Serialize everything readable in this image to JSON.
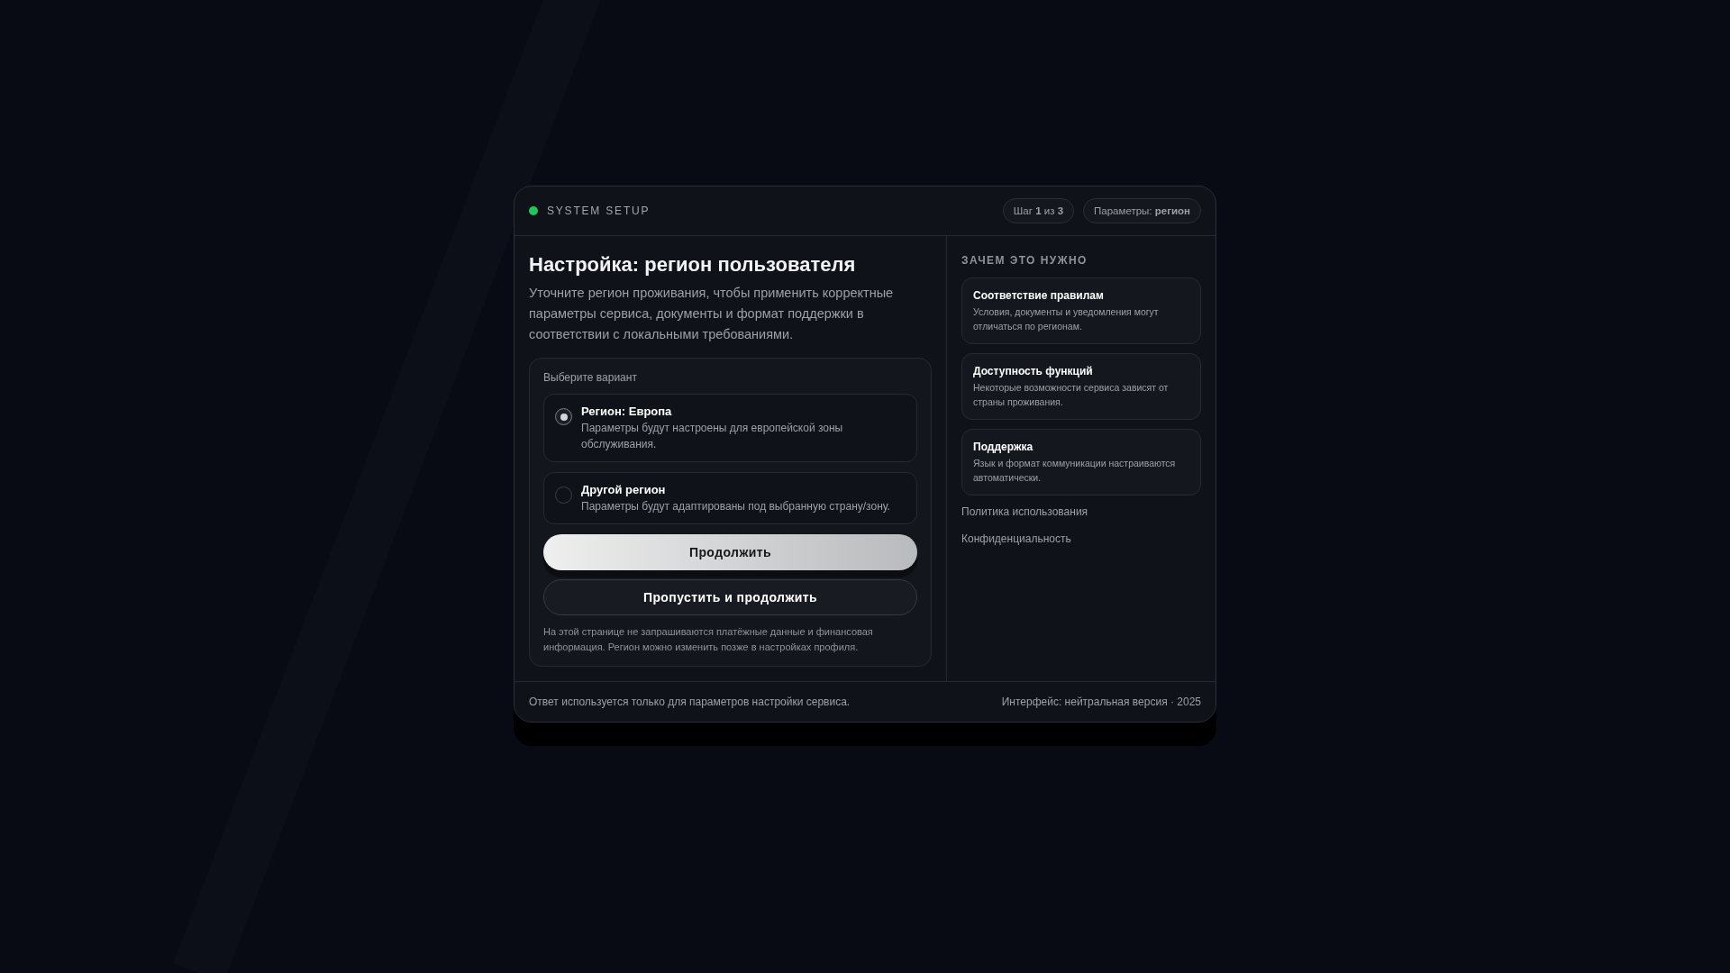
{
  "header": {
    "title": "SYSTEM SETUP",
    "online": true,
    "badges": [
      "Шаг **1** из **3**",
      "Параметры: **регион**"
    ]
  },
  "main": {
    "title": "Настройка: регион пользователя",
    "description": "Уточните регион проживания, чтобы применить корректные параметры сервиса, документы и формат поддержки в соответствии с локальными требованиями.",
    "form": {
      "label": "Выберите вариант",
      "options": [
        {
          "title": "Регион: Европа",
          "description": "Параметры будут настроены для европейской зоны обслуживания.",
          "selected": true
        },
        {
          "title": "Другой регион",
          "description": "Параметры будут адаптированы под выбранную страну/зону.",
          "selected": false
        }
      ],
      "buttons": [
        {
          "label": "Продолжить",
          "kind": "primary"
        },
        {
          "label": "Пропустить и продолжить",
          "kind": "secondary"
        }
      ],
      "note": "На этой странице не запрашиваются платёжные данные и финансовая информация. Регион можно изменить позже в настройках профиля."
    }
  },
  "sidebar": {
    "title": "ЗАЧЕМ ЭТО НУЖНО",
    "cards": [
      {
        "title": "Соответствие правилам",
        "text": "Условия, документы и уведомления могут отличаться по регионам."
      },
      {
        "title": "Доступность функций",
        "text": "Некоторые возможности сервиса зависят от страны проживания."
      },
      {
        "title": "Поддержка",
        "text": "Язык и формат коммуникации настраиваются автоматически."
      }
    ],
    "links": [
      "Политика использования",
      "Конфиденциальность"
    ]
  },
  "footer": {
    "left": "Ответ используется только для параметров настройки сервиса.",
    "right": "Интерфейс: нейтральная версия · 2025"
  }
}
